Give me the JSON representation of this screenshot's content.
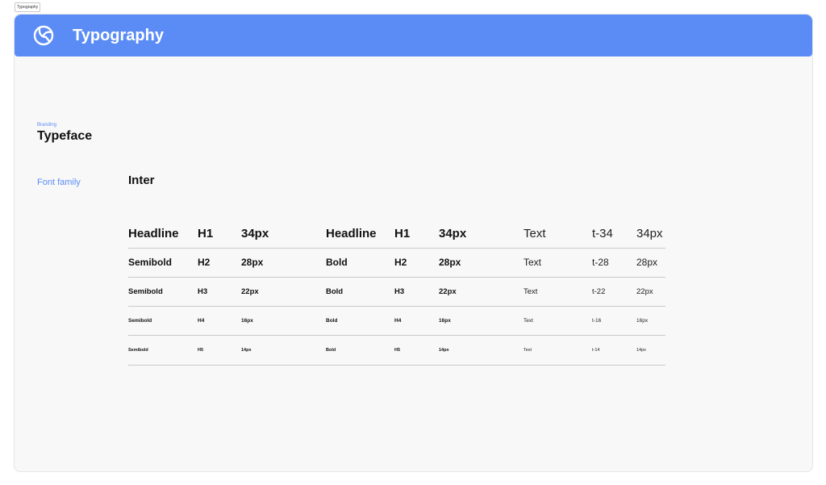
{
  "frame_tag": "Typography",
  "header": {
    "title": "Typography",
    "logo_icon": "leaf-in-circle-icon"
  },
  "section": {
    "eyebrow": "Branding",
    "title": "Typeface"
  },
  "font_family": {
    "label": "Font family",
    "value": "Inter"
  },
  "type_scale": {
    "rows": [
      {
        "s1": "Headline",
        "s2": "H1",
        "s3": "34px",
        "b1": "Headline",
        "b2": "H1",
        "b3": "34px",
        "t1": "Text",
        "t2": "t-34",
        "t3": "34px"
      },
      {
        "s1": "Semibold",
        "s2": "H2",
        "s3": "28px",
        "b1": "Bold",
        "b2": "H2",
        "b3": "28px",
        "t1": "Text",
        "t2": "t-28",
        "t3": "28px"
      },
      {
        "s1": "Semibold",
        "s2": "H3",
        "s3": "22px",
        "b1": "Bold",
        "b2": "H3",
        "b3": "22px",
        "t1": "Text",
        "t2": "t-22",
        "t3": "22px"
      },
      {
        "s1": "Semibold",
        "s2": "H4",
        "s3": "16px",
        "b1": "Bold",
        "b2": "H4",
        "b3": "16px",
        "t1": "Text",
        "t2": "t-16",
        "t3": "16px"
      },
      {
        "s1": "Semibold",
        "s2": "H5",
        "s3": "14px",
        "b1": "Bold",
        "b2": "H5",
        "b3": "14px",
        "t1": "Text",
        "t2": "t-14",
        "t3": "14px"
      }
    ]
  },
  "colors": {
    "accent": "#5b8cf6",
    "canvas": "#f8f8f8",
    "divider": "#c9c9c9"
  }
}
